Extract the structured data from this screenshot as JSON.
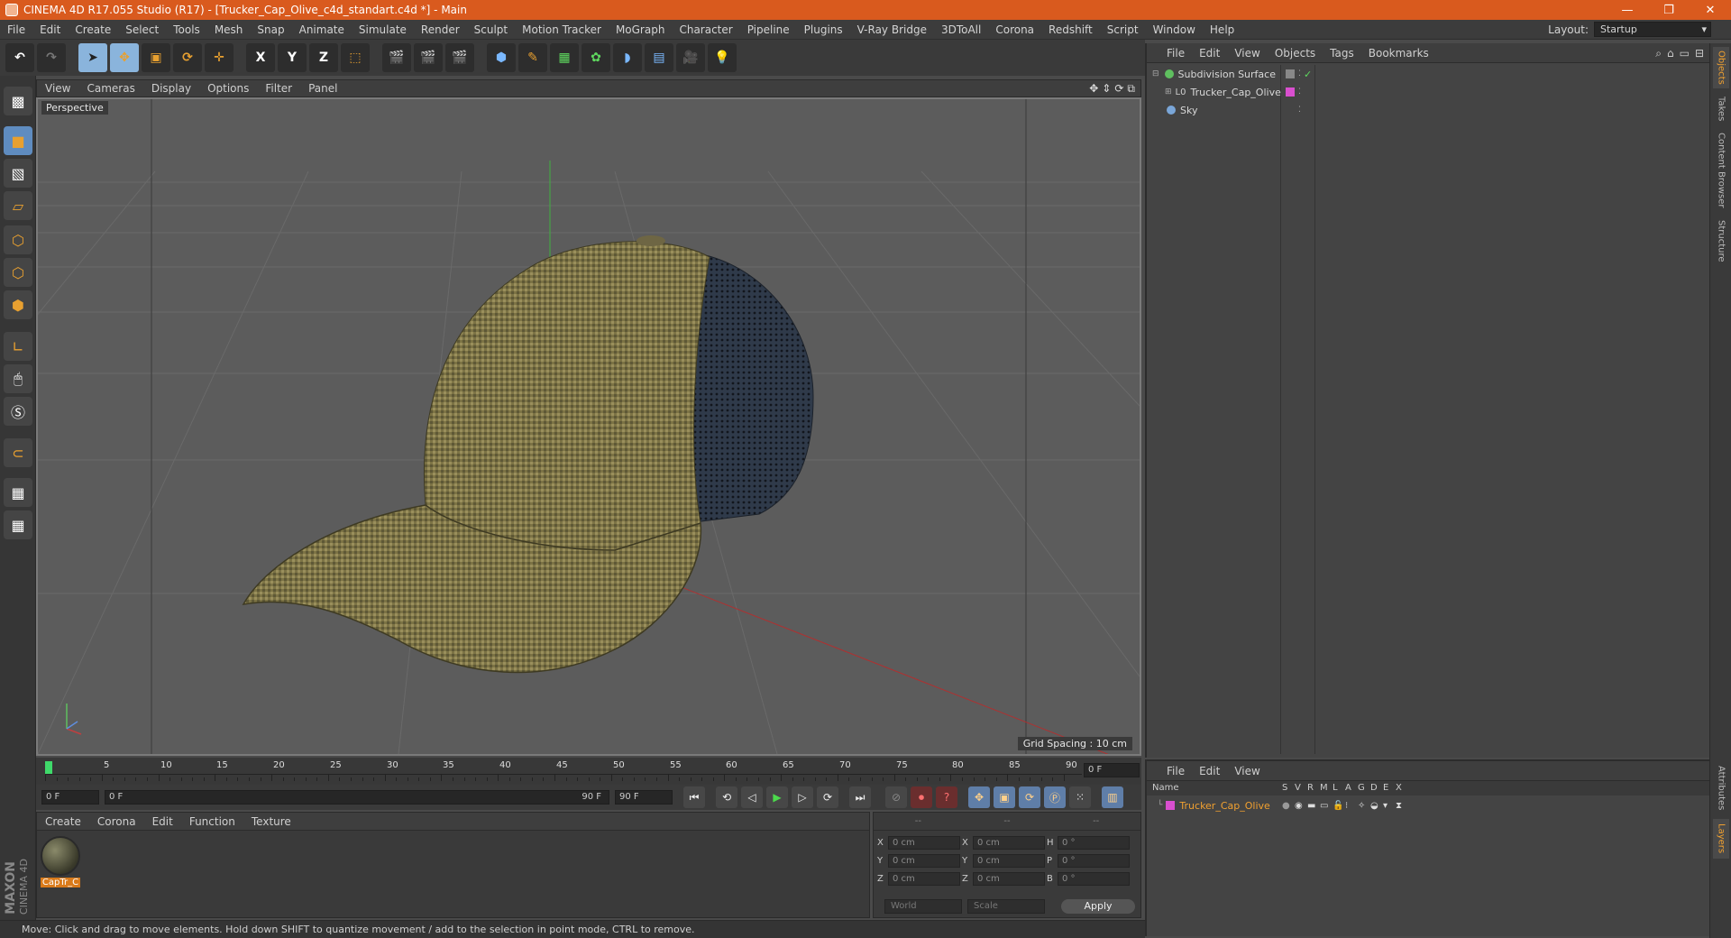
{
  "titlebar": {
    "title": "CINEMA 4D R17.055 Studio (R17) - [Trucker_Cap_Olive_c4d_standart.c4d *] - Main",
    "minimize": "—",
    "restore": "❐",
    "close": "✕"
  },
  "menubar": {
    "items": [
      "File",
      "Edit",
      "Create",
      "Select",
      "Tools",
      "Mesh",
      "Snap",
      "Animate",
      "Simulate",
      "Render",
      "Sculpt",
      "Motion Tracker",
      "MoGraph",
      "Character",
      "Pipeline",
      "Plugins",
      "V-Ray Bridge",
      "3DToAll",
      "Corona",
      "Redshift",
      "Script",
      "Window",
      "Help"
    ],
    "layout_label": "Layout:",
    "layout_value": "Startup"
  },
  "toolbar": {
    "axis_x": "X",
    "axis_y": "Y",
    "axis_z": "Z"
  },
  "viewport": {
    "menu": [
      "View",
      "Cameras",
      "Display",
      "Options",
      "Filter",
      "Panel"
    ],
    "camera_label": "Perspective",
    "grid_spacing": "Grid Spacing : 10 cm"
  },
  "timeline": {
    "ticks": [
      "0",
      "5",
      "10",
      "15",
      "20",
      "25",
      "30",
      "35",
      "40",
      "45",
      "50",
      "55",
      "60",
      "65",
      "70",
      "75",
      "80",
      "85",
      "90"
    ],
    "current_frame": "0 F",
    "end_frame_display": "0 F"
  },
  "transport": {
    "start_field": "0 F",
    "range_start": "0 F",
    "range_end": "90 F",
    "end_field": "90 F"
  },
  "material_manager": {
    "menu": [
      "Create",
      "Corona",
      "Edit",
      "Function",
      "Texture"
    ],
    "materials": [
      {
        "label": "CapTr_C"
      }
    ]
  },
  "brand": {
    "maxon": "MAXON",
    "c4d": "CINEMA 4D"
  },
  "coordinates": {
    "head": [
      "--",
      "--",
      "--"
    ],
    "rows": [
      {
        "a1": "X",
        "v1": "0 cm",
        "a2": "X",
        "v2": "0 cm",
        "a3": "H",
        "v3": "0 °"
      },
      {
        "a1": "Y",
        "v1": "0 cm",
        "a2": "Y",
        "v2": "0 cm",
        "a3": "P",
        "v3": "0 °"
      },
      {
        "a1": "Z",
        "v1": "0 cm",
        "a2": "Z",
        "v2": "0 cm",
        "a3": "B",
        "v3": "0 °"
      }
    ],
    "world": "World",
    "scale": "Scale",
    "apply": "Apply"
  },
  "status": {
    "text": "Move: Click and drag to move elements. Hold down SHIFT to quantize movement / add to the selection in point mode, CTRL to remove."
  },
  "object_manager": {
    "menu": [
      "File",
      "Edit",
      "View",
      "Objects",
      "Tags",
      "Bookmarks"
    ],
    "objects": [
      {
        "name": "Subdivision Surface",
        "icon_color": "#5fbf5f"
      },
      {
        "name": "Trucker_Cap_Olive",
        "icon_color": "#cfcfcf"
      },
      {
        "name": "Sky",
        "icon_color": "#7aa6d8"
      }
    ]
  },
  "layer_manager": {
    "menu": [
      "File",
      "Edit",
      "View"
    ],
    "headers": [
      "Name",
      "S",
      "V",
      "R",
      "M",
      "L",
      "A",
      "G",
      "D",
      "E",
      "X"
    ],
    "layers": [
      {
        "name": "Trucker_Cap_Olive",
        "color": "#d94fcf"
      }
    ]
  },
  "right_tabs": [
    "Objects",
    "Takes",
    "Content Browser",
    "Structure",
    "Attributes",
    "Layers"
  ],
  "colors": {
    "accent_orange": "#d95a1e",
    "selected_orange": "#f0a030"
  }
}
